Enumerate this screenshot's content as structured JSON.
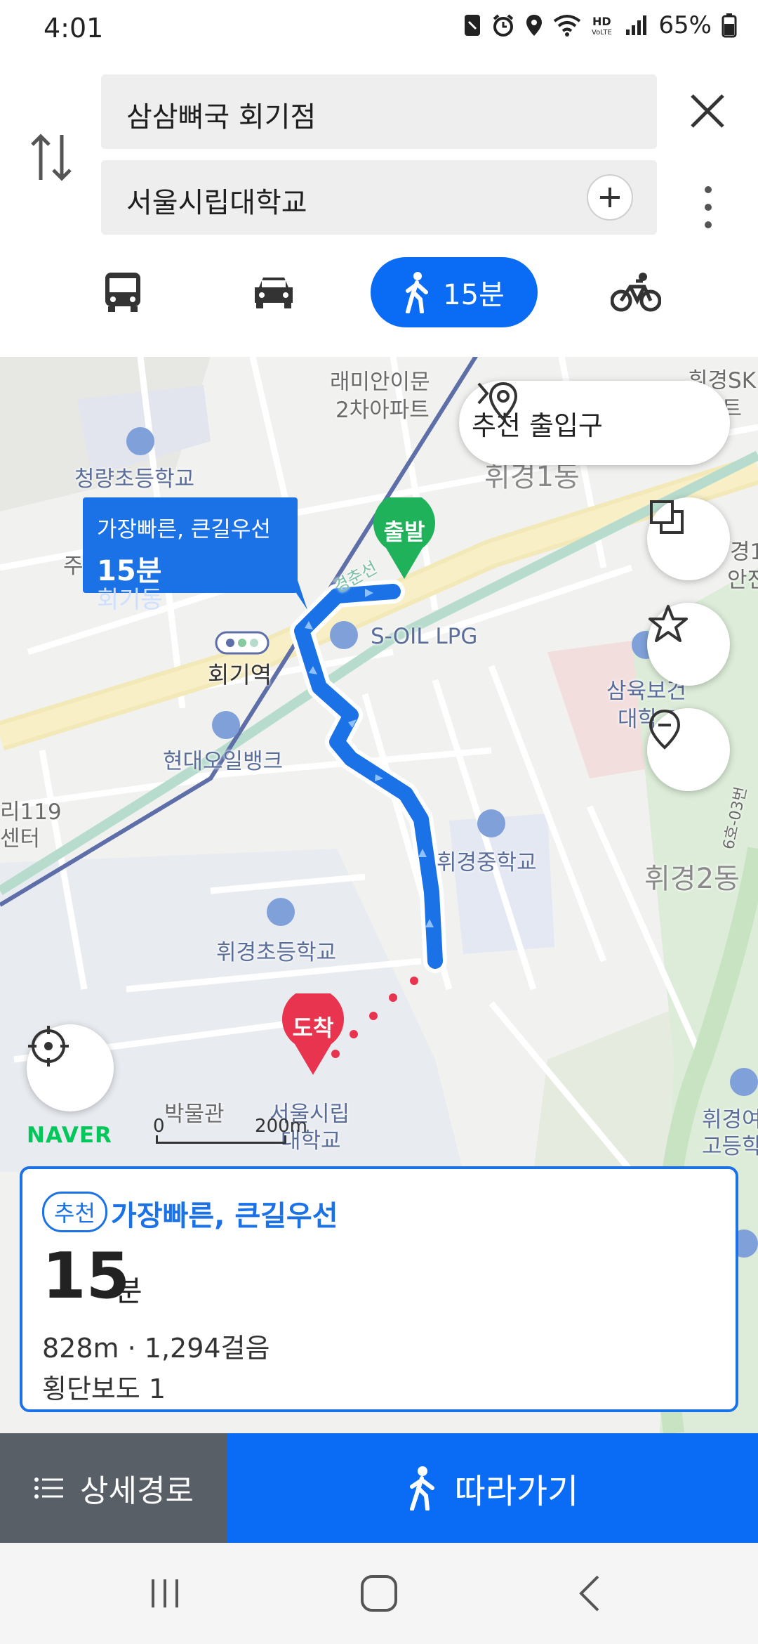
{
  "status": {
    "time": "4:01",
    "battery": "65%"
  },
  "search": {
    "origin": "삼삼뼈국 회기점",
    "destination": "서울시립대학교"
  },
  "modes": {
    "walk_time": "15분",
    "items": [
      "bus-icon",
      "car-icon",
      "walk-icon",
      "bicycle-icon"
    ]
  },
  "map": {
    "entrance_button": "추천 출입구",
    "route_bubble": {
      "title": "가장빠른, 큰길우선",
      "time": "15분"
    },
    "start_marker": "출발",
    "end_marker": "도착",
    "labels": {
      "apartment_1": "래미안이문",
      "apartment_2": "2차아파트",
      "dong_1": "휘경1동",
      "school_1": "청량초등학교",
      "center_1": "회기동",
      "center_2": "주민센터",
      "railway": "경춘선",
      "gas_station": "S-OIL LPG",
      "station": "회기역",
      "bank": "현대오일뱅크",
      "fire_1": "리119",
      "fire_2": "센터",
      "middle_school": "휘경중학교",
      "elementary": "휘경초등학교",
      "dong_2": "휘경2동",
      "univ_1": "서울시립",
      "univ_2": "대학교",
      "museum": "박물관",
      "health_1": "삼육보건",
      "health_2": "대학교",
      "sk_1": "휘경SK",
      "sk_2": "파트",
      "safety_1": "경1",
      "safety_2": "안전센",
      "hs_1": "휘경여",
      "hs_2": "고등학",
      "road": "6호-03번"
    },
    "logo": "NAVER",
    "scale": {
      "zero": "0",
      "distance": "200m"
    }
  },
  "summary": {
    "badge": "추천",
    "route_name": "가장빠른, 큰길우선",
    "duration_value": "15",
    "duration_unit": "분",
    "distance_steps": "828m · 1,294걸음",
    "crosswalk": "횡단보도 1"
  },
  "actions": {
    "detail_label": "상세경로",
    "follow_label": "따라가기"
  },
  "colors": {
    "primary": "#0a6cf5",
    "route": "#1b72e6",
    "start_marker": "#1fb25a",
    "end_marker": "#e8344e",
    "naver": "#03c75a"
  }
}
